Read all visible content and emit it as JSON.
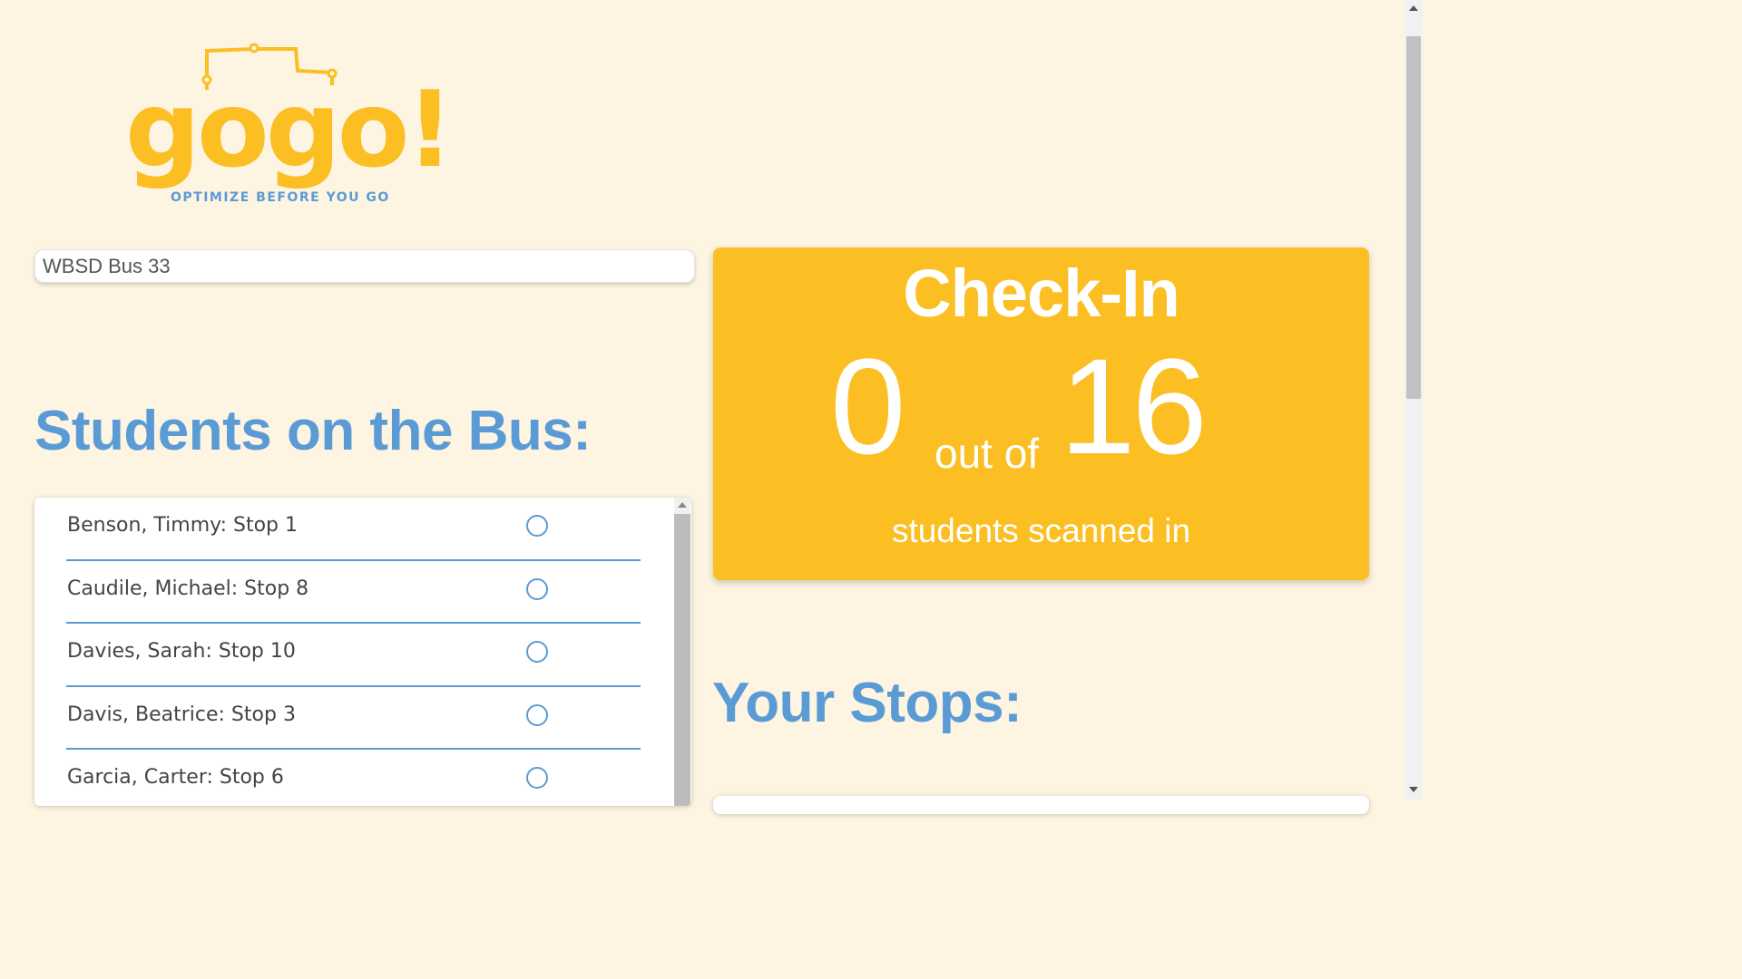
{
  "brand": {
    "logo_text": "gogo!",
    "tagline": "OPTIMIZE BEFORE YOU GO",
    "primary_color": "#fbbf23",
    "accent_color": "#5b9bd5",
    "background_color": "#fdf4e2"
  },
  "bus_field": {
    "value": "WBSD Bus 33"
  },
  "students_section": {
    "title": "Students on the Bus:",
    "items": [
      {
        "label": "Benson, Timmy: Stop 1",
        "checked": false
      },
      {
        "label": "Caudile, Michael: Stop 8",
        "checked": false
      },
      {
        "label": "Davies, Sarah: Stop 10",
        "checked": false
      },
      {
        "label": "Davis, Beatrice: Stop 3",
        "checked": false
      },
      {
        "label": "Garcia, Carter: Stop 6",
        "checked": false
      }
    ]
  },
  "checkin": {
    "title": "Check-In",
    "scanned": "0",
    "out_of": "out of",
    "total": "16",
    "subtitle": "students scanned in"
  },
  "stops_section": {
    "title": "Your Stops:"
  }
}
